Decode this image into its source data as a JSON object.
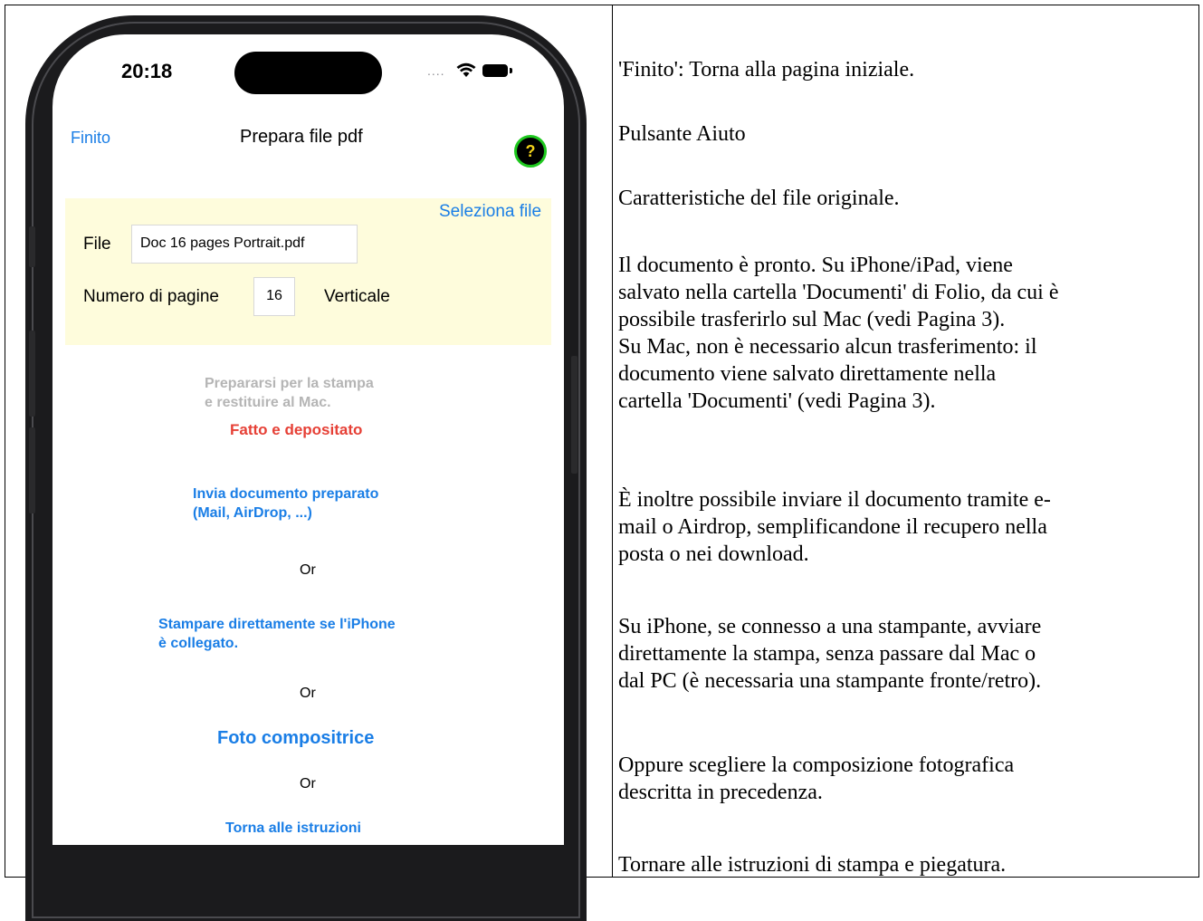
{
  "status_bar": {
    "time": "20:18",
    "signal_dots": "....",
    "icons": [
      "wifi-icon",
      "battery-icon"
    ]
  },
  "nav": {
    "done_label": "Finito",
    "title": "Prepara file pdf",
    "help_label": "?"
  },
  "file_panel": {
    "select_file_label": "Seleziona file",
    "file_label": "File",
    "file_name": "Doc 16 pages Portrait.pdf",
    "pages_label": "Numero di pagine",
    "pages_value": "16",
    "orientation": "Verticale"
  },
  "actions": {
    "prepare_label": "Prepararsi per la stampa\ne restituire al Mac.",
    "done_status": "Fatto e depositato",
    "send_label": "Invia documento preparato\n(Mail, AirDrop, ...)",
    "or_1": "Or",
    "print_label": "Stampare direttamente se l'iPhone\nè collegato.",
    "or_2": "Or",
    "photo_label": "Foto compositrice",
    "or_3": "Or",
    "back_label": "Torna alle istruzioni"
  },
  "descriptions": {
    "finito": "'Finito': Torna alla pagina iniziale.",
    "help": "Pulsante Aiuto",
    "file": "Caratteristiche del file originale.",
    "ready": "Il documento è pronto. Su iPhone/iPad, viene\nsalvato nella cartella 'Documenti' di Folio, da cui è\npossibile trasferirlo sul Mac (vedi Pagina 3).\nSu Mac, non è necessario alcun trasferimento: il\ndocumento viene salvato direttamente nella\ncartella 'Documenti' (vedi Pagina 3).",
    "send": "È inoltre possibile inviare il documento tramite e-\nmail o Airdrop, semplificandone il recupero nella\nposta o nei download.",
    "print": "Su iPhone, se connesso a una stampante, avviare\ndirettamente la stampa, senza passare dal Mac o\ndal PC (è necessaria una stampante fronte/retro).",
    "photo": "Oppure scegliere la composizione fotografica\ndescritta in precedenza.",
    "back": "Tornare alle istruzioni di stampa e piegatura."
  },
  "colors": {
    "link": "#1a7ee6",
    "done_red": "#e64036",
    "panel_bg": "#fefcdc",
    "help_ring": "#1ec81e",
    "help_mark": "#f2d21b"
  }
}
